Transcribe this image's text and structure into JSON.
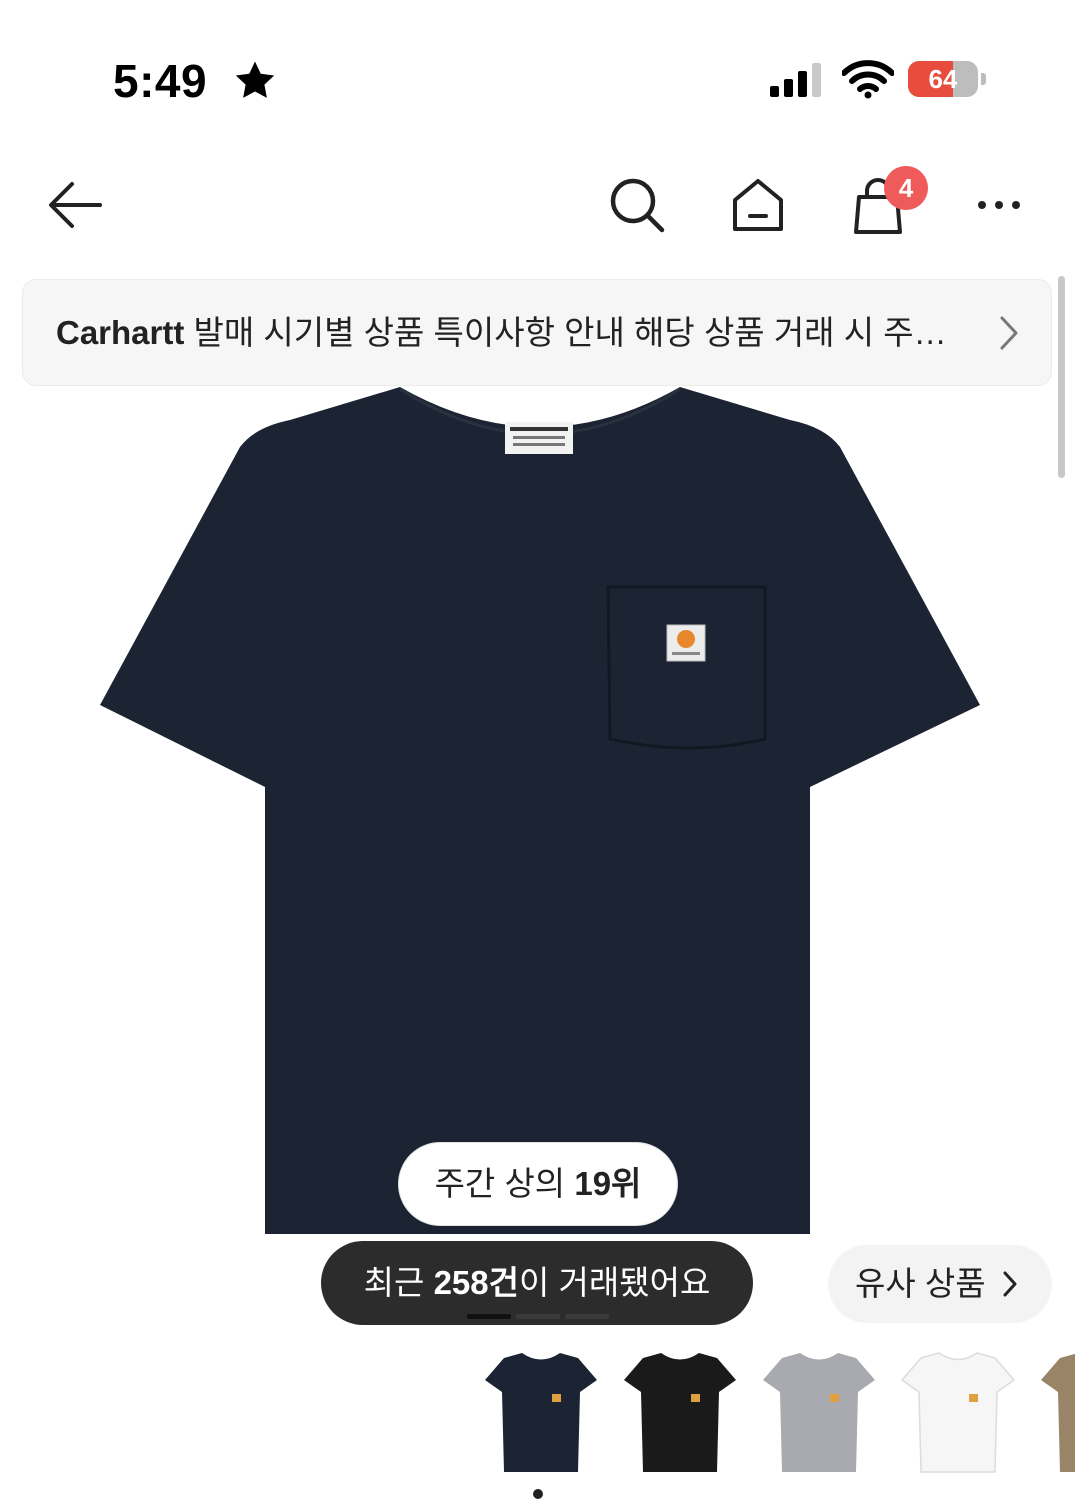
{
  "status_bar": {
    "time": "5:49",
    "battery_level": "64",
    "battery_color": "#e74c3c",
    "icons": [
      "star-icon",
      "cellular-signal-icon",
      "wifi-icon",
      "battery-icon"
    ]
  },
  "nav": {
    "cart_count": "4",
    "icons": [
      "back-arrow-icon",
      "search-icon",
      "home-icon",
      "shopping-bag-icon",
      "more-icon"
    ]
  },
  "notice": {
    "brand": "Carhartt",
    "text": " 발매 시기별 상품 특이사항 안내 해당 상품 거래 시 주의사항을 확인해주세요"
  },
  "product": {
    "rank_prefix": "주간 상의 ",
    "rank_value": "19위",
    "trade_prefix": "최근 ",
    "trade_count": "258건",
    "trade_suffix": "이 거래됐어요",
    "similar_label": "유사 상품",
    "main_color": "#1c2433",
    "gallery_pages": 3,
    "gallery_active_page": 1
  },
  "thumbnails": [
    {
      "name": "navy",
      "color": "#1c2433"
    },
    {
      "name": "black",
      "color": "#1a1a1a"
    },
    {
      "name": "heather-grey",
      "color": "#a9aab0"
    },
    {
      "name": "white",
      "color": "#f6f6f6"
    },
    {
      "name": "brown",
      "color": "#9a8468"
    }
  ]
}
